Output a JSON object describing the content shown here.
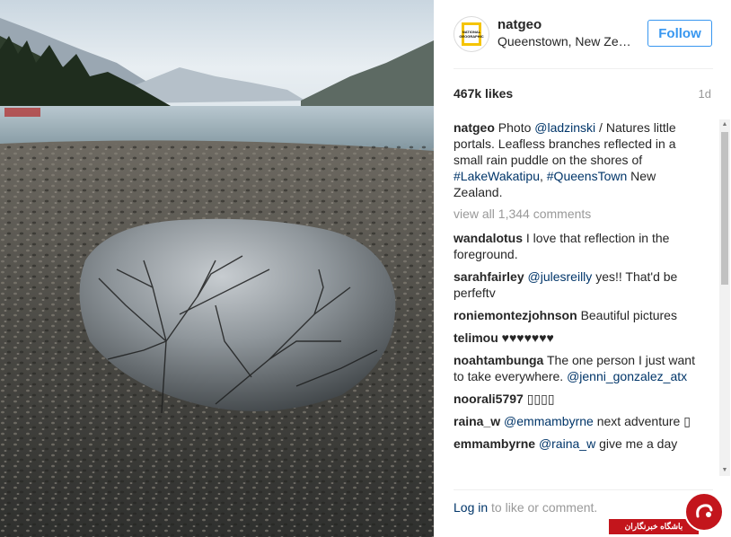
{
  "post": {
    "username": "natgeo",
    "location": "Queenstown, New Zealand",
    "follow_label": "Follow",
    "likes": "467k likes",
    "time_ago": "1d",
    "avatar_text": "NATIONAL GEOGRAPHIC",
    "photo_icon": "landscape-photo"
  },
  "caption": {
    "username": "natgeo",
    "prefix": "Photo ",
    "mention": "@ladzinski",
    "text1": " / Natures little portals. Leafless branches reflected in a small rain puddle on the shores of ",
    "tag1": "#LakeWakatipu",
    "sep": ", ",
    "tag2": "#QueensTown",
    "text2": " New Zealand."
  },
  "view_all": "view all 1,344 comments",
  "comments": [
    {
      "user": "wandalotus",
      "text": "I love that reflection in the foreground."
    },
    {
      "user": "sarahfairley",
      "mention": "@julesreilly",
      "text": "yes!! That'd be perfeftv"
    },
    {
      "user": "roniemontezjohnson",
      "text": "Beautiful pictures"
    },
    {
      "user": "telimou",
      "text": "♥♥♥♥♥♥♥"
    },
    {
      "user": "noahtambunga",
      "text": "The one person I just want to take everywhere.",
      "mention": "@jenni_gonzalez_atx"
    },
    {
      "user": "noorali5797",
      "text": "▯▯▯▯"
    },
    {
      "user": "raina_w",
      "mention": "@emmambyrne",
      "text": "next adventure ▯"
    },
    {
      "user": "emmambyrne",
      "mention": "@raina_w",
      "text": "give me a day"
    }
  ],
  "footer": {
    "login_link": "Log in",
    "login_text": " to like or comment."
  },
  "watermark": {
    "text": "باشگاه خبرنگاران",
    "logo_icon": "news-club-logo"
  },
  "colors": {
    "link": "#003569",
    "follow": "#3897f0",
    "muted": "#999999",
    "watermark": "#c3151c"
  }
}
